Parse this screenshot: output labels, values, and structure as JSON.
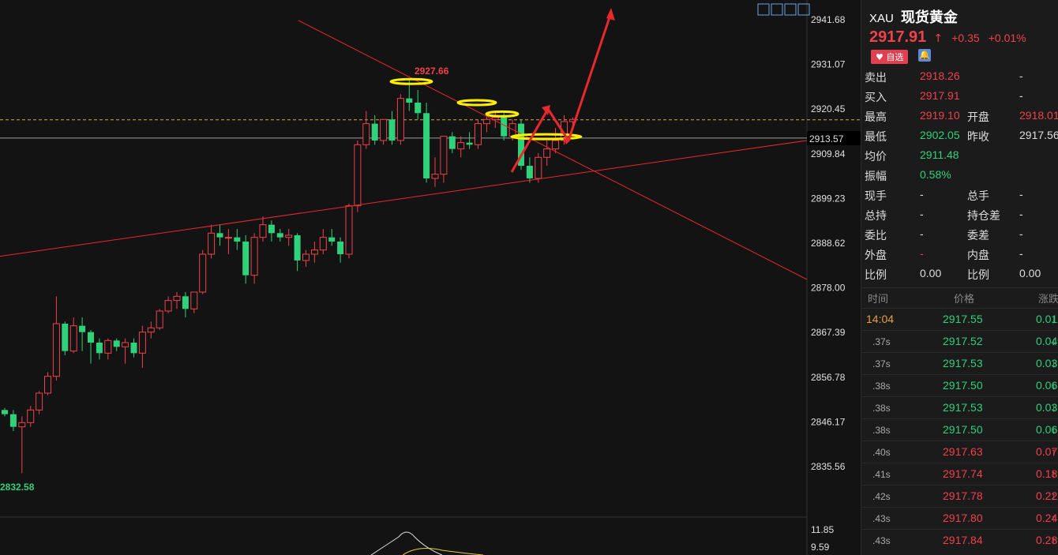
{
  "chart_data": {
    "type": "candlestick",
    "ylim": [
      2832.0,
      2944.5
    ],
    "y_ticks": [
      "2941.68",
      "2931.07",
      "2920.45",
      "2909.84",
      "2899.23",
      "2888.62",
      "2878.00",
      "2867.39",
      "2856.78",
      "2846.17",
      "2835.56"
    ],
    "current_price_label": "2913.57",
    "annotations": {
      "high_label": "2927.66",
      "low_label": "2832.58"
    },
    "reference_lines": {
      "dashed_price": 2917.91,
      "solid_price": 2913.57
    },
    "candles": [
      [
        2849.0,
        2849.5,
        2847.5,
        2848.0
      ],
      [
        2848.0,
        2849.0,
        2844.0,
        2845.0
      ],
      [
        2845.0,
        2847.5,
        2834.0,
        2846.0
      ],
      [
        2846.0,
        2850.0,
        2845.0,
        2849.0
      ],
      [
        2849.0,
        2853.5,
        2848.0,
        2853.0
      ],
      [
        2853.0,
        2858.0,
        2852.5,
        2857.0
      ],
      [
        2857.0,
        2876.0,
        2856.0,
        2869.5
      ],
      [
        2869.5,
        2870.0,
        2862.0,
        2863.0
      ],
      [
        2863.0,
        2871.0,
        2862.5,
        2869.0
      ],
      [
        2869.0,
        2871.0,
        2863.0,
        2867.5
      ],
      [
        2867.5,
        2868.0,
        2860.0,
        2865.0
      ],
      [
        2865.0,
        2866.0,
        2861.0,
        2862.5
      ],
      [
        2862.5,
        2866.0,
        2861.0,
        2865.5
      ],
      [
        2865.5,
        2866.0,
        2863.0,
        2864.0
      ],
      [
        2864.0,
        2866.0,
        2860.0,
        2865.0
      ],
      [
        2865.0,
        2866.0,
        2861.5,
        2862.5
      ],
      [
        2862.5,
        2869.0,
        2859.0,
        2867.5
      ],
      [
        2867.5,
        2870.0,
        2866.0,
        2868.5
      ],
      [
        2868.5,
        2873.0,
        2868.0,
        2872.5
      ],
      [
        2872.5,
        2876.0,
        2872.0,
        2875.0
      ],
      [
        2875.0,
        2877.0,
        2873.0,
        2876.0
      ],
      [
        2876.0,
        2877.0,
        2871.0,
        2873.0
      ],
      [
        2873.0,
        2877.0,
        2872.0,
        2877.0
      ],
      [
        2877.0,
        2887.0,
        2876.5,
        2886.0
      ],
      [
        2886.0,
        2893.0,
        2885.0,
        2891.0
      ],
      [
        2891.0,
        2893.0,
        2888.0,
        2890.0
      ],
      [
        2890.0,
        2892.0,
        2886.0,
        2890.0
      ],
      [
        2890.0,
        2892.0,
        2887.0,
        2889.0
      ],
      [
        2889.0,
        2890.5,
        2879.0,
        2881.0
      ],
      [
        2881.0,
        2891.0,
        2879.0,
        2890.0
      ],
      [
        2890.0,
        2895.0,
        2889.0,
        2893.0
      ],
      [
        2893.0,
        2894.0,
        2889.0,
        2891.0
      ],
      [
        2891.0,
        2892.0,
        2889.0,
        2890.0
      ],
      [
        2890.0,
        2892.0,
        2888.0,
        2890.5
      ],
      [
        2890.5,
        2891.0,
        2882.0,
        2884.5
      ],
      [
        2884.5,
        2887.0,
        2883.0,
        2886.0
      ],
      [
        2886.0,
        2889.0,
        2884.0,
        2887.0
      ],
      [
        2887.0,
        2892.0,
        2886.0,
        2890.0
      ],
      [
        2890.0,
        2892.0,
        2888.0,
        2889.0
      ],
      [
        2889.0,
        2890.0,
        2884.0,
        2886.0
      ],
      [
        2886.0,
        2898.0,
        2885.0,
        2897.5
      ],
      [
        2897.5,
        2913.0,
        2896.0,
        2912.0
      ],
      [
        2912.0,
        2920.0,
        2911.0,
        2917.0
      ],
      [
        2917.0,
        2919.0,
        2912.0,
        2913.0
      ],
      [
        2913.0,
        2918.0,
        2912.0,
        2918.0
      ],
      [
        2918.0,
        2920.0,
        2912.0,
        2913.0
      ],
      [
        2913.0,
        2924.0,
        2912.0,
        2923.0
      ],
      [
        2923.0,
        2927.66,
        2920.0,
        2922.0
      ],
      [
        2922.0,
        2925.0,
        2918.0,
        2919.5
      ],
      [
        2919.5,
        2922.0,
        2903.0,
        2904.0
      ],
      [
        2904.0,
        2909.0,
        2902.0,
        2905.0
      ],
      [
        2905.0,
        2914.0,
        2903.0,
        2914.0
      ],
      [
        2914.0,
        2915.0,
        2910.0,
        2911.0
      ],
      [
        2911.0,
        2914.0,
        2909.0,
        2912.5
      ],
      [
        2912.5,
        2915.0,
        2911.0,
        2912.0
      ],
      [
        2912.0,
        2918.0,
        2911.0,
        2917.0
      ],
      [
        2917.0,
        2919.0,
        2915.0,
        2918.0
      ],
      [
        2918.0,
        2920.0,
        2916.0,
        2918.5
      ],
      [
        2918.5,
        2919.5,
        2913.0,
        2914.0
      ],
      [
        2914.0,
        2918.0,
        2913.0,
        2917.0
      ],
      [
        2917.0,
        2918.0,
        2906.0,
        2907.0
      ],
      [
        2907.0,
        2909.0,
        2903.0,
        2904.0
      ],
      [
        2904.0,
        2910.0,
        2903.0,
        2909.0
      ],
      [
        2909.0,
        2913.0,
        2907.0,
        2911.0
      ],
      [
        2911.0,
        2916.0,
        2910.0,
        2913.0
      ],
      [
        2913.0,
        2919.0,
        2912.0,
        2917.5
      ],
      [
        2917.5,
        2918.5,
        2916.0,
        2918.0
      ]
    ],
    "indicator_ticks": [
      "11.85",
      "9.59"
    ]
  },
  "panel": {
    "symbol": "XAU",
    "name": "现货黄金",
    "price": "2917.91",
    "change": "+0.35",
    "change_pct": "+0.01%",
    "fav_label": "自选",
    "rows": [
      {
        "k1": "卖出",
        "v1": "2918.26",
        "c1": "red",
        "k2": "",
        "v2": "-",
        "c2": "white"
      },
      {
        "k1": "买入",
        "v1": "2917.91",
        "c1": "red",
        "k2": "",
        "v2": "-",
        "c2": "white"
      },
      {
        "k1": "最高",
        "v1": "2919.10",
        "c1": "red",
        "k2": "开盘",
        "v2": "2918.01",
        "c2": "red"
      },
      {
        "k1": "最低",
        "v1": "2902.05",
        "c1": "green",
        "k2": "昨收",
        "v2": "2917.56",
        "c2": "white"
      },
      {
        "k1": "均价",
        "v1": "2911.48",
        "c1": "green",
        "k2": "",
        "v2": "",
        "c2": "white"
      },
      {
        "k1": "振幅",
        "v1": "0.58%",
        "c1": "green",
        "k2": "",
        "v2": "",
        "c2": "white"
      },
      {
        "k1": "现手",
        "v1": "-",
        "c1": "white",
        "k2": "总手",
        "v2": "-",
        "c2": "white"
      },
      {
        "k1": "总持",
        "v1": "-",
        "c1": "white",
        "k2": "持仓差",
        "v2": "-",
        "c2": "white"
      },
      {
        "k1": "委比",
        "v1": "-",
        "c1": "white",
        "k2": "委差",
        "v2": "-",
        "c2": "white"
      },
      {
        "k1": "外盘",
        "v1": "-",
        "c1": "red",
        "k2": "内盘",
        "v2": "-",
        "c2": "white"
      },
      {
        "k1": "比例",
        "v1": "0.00",
        "c1": "white",
        "k2": "比例",
        "v2": "0.00",
        "c2": "white"
      }
    ],
    "trade_header": {
      "time": "时间",
      "price": "价格",
      "change": "涨跌"
    },
    "trades": [
      {
        "t": "14:04",
        "p": "2917.55",
        "c": "0.01",
        "dir": "down"
      },
      {
        "t": ".37s",
        "p": "2917.52",
        "c": "0.04",
        "dir": "down"
      },
      {
        "t": ".37s",
        "p": "2917.53",
        "c": "0.03",
        "dir": "down"
      },
      {
        "t": ".38s",
        "p": "2917.50",
        "c": "0.06",
        "dir": "down"
      },
      {
        "t": ".38s",
        "p": "2917.53",
        "c": "0.03",
        "dir": "down"
      },
      {
        "t": ".38s",
        "p": "2917.50",
        "c": "0.06",
        "dir": "down"
      },
      {
        "t": ".40s",
        "p": "2917.63",
        "c": "0.07",
        "dir": "up"
      },
      {
        "t": ".41s",
        "p": "2917.74",
        "c": "0.18",
        "dir": "up"
      },
      {
        "t": ".42s",
        "p": "2917.78",
        "c": "0.22",
        "dir": "up"
      },
      {
        "t": ".43s",
        "p": "2917.80",
        "c": "0.24",
        "dir": "up"
      },
      {
        "t": ".43s",
        "p": "2917.84",
        "c": "0.28",
        "dir": "up"
      }
    ]
  },
  "colors": {
    "up": "#f0414c",
    "down": "#2fd17a",
    "trend": "#e8282c",
    "highlight": "#ffee00"
  }
}
